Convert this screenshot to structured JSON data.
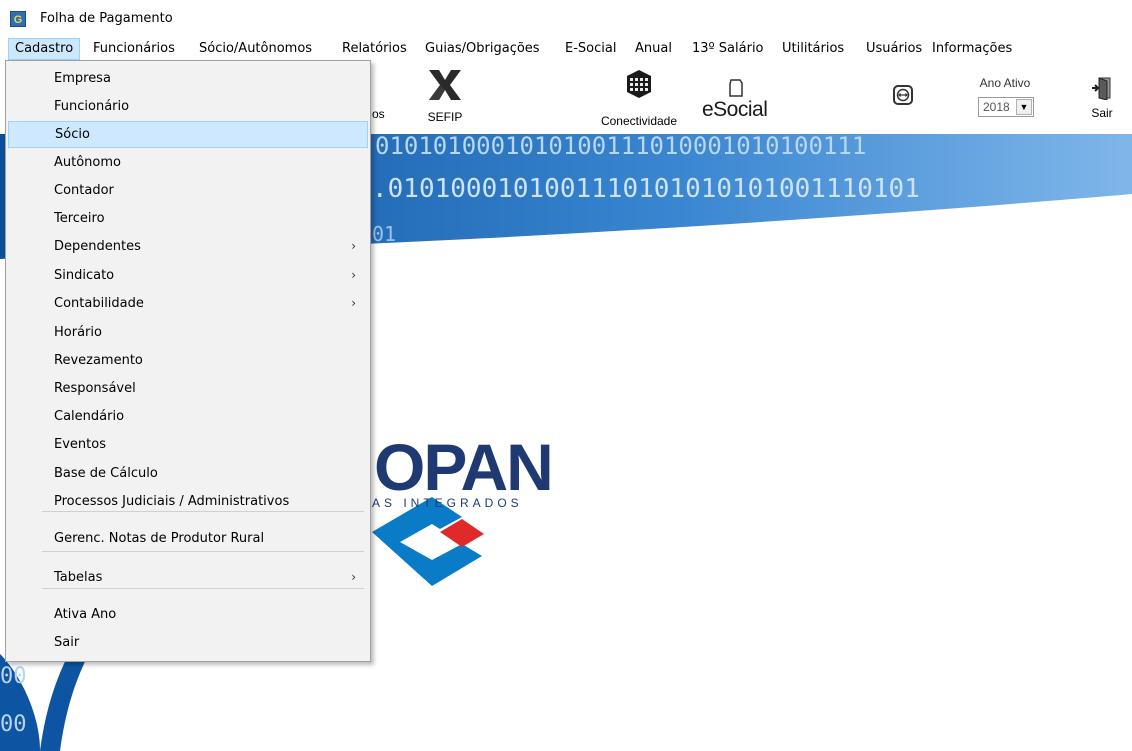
{
  "window": {
    "title": "Folha de Pagamento",
    "app_icon": "G"
  },
  "menubar": [
    "Cadastro",
    "Funcionários",
    "Sócio/Autônomos",
    "Relatórios",
    "Guias/Obrigações",
    "E-Social",
    "Anual",
    "13º Salário",
    "Utilitários",
    "Usuários",
    "Informações"
  ],
  "toolbar": {
    "partial_label": "os",
    "sefip_label": "SEFIP",
    "conectividade_label": "Conectividade",
    "esocial_label": "eSocial",
    "ano_ativo_label": "Ano Ativo",
    "ano_ativo_value": "2018",
    "sair_label": "Sair"
  },
  "banner": {
    "bits_row1": "0101010001010100111010001010100111",
    "bits_row2": ".0101000101001110101010101001110101",
    "bits_row3": "01",
    "bits_left1": "00",
    "bits_left2": "00",
    "logo_text": "OPAN",
    "logo_sub": "AS INTEGRADOS"
  },
  "cadastro_menu": {
    "items": [
      {
        "label": "Empresa",
        "sub": false
      },
      {
        "label": "Funcionário",
        "sub": false
      },
      {
        "label": "Sócio",
        "sub": false
      },
      {
        "label": "Autônomo",
        "sub": false
      },
      {
        "label": "Contador",
        "sub": false
      },
      {
        "label": "Terceiro",
        "sub": false
      },
      {
        "label": "Dependentes",
        "sub": true
      },
      {
        "label": "Sindicato",
        "sub": true
      },
      {
        "label": "Contabilidade",
        "sub": true
      },
      {
        "label": "Horário",
        "sub": false
      },
      {
        "label": "Revezamento",
        "sub": false
      },
      {
        "label": "Responsável",
        "sub": false
      },
      {
        "label": "Calendário",
        "sub": false
      },
      {
        "label": "Eventos",
        "sub": false
      },
      {
        "label": "Base de Cálculo",
        "sub": false
      },
      {
        "label": "Processos Judiciais / Administrativos",
        "sub": false
      },
      {
        "label": "Gerenc. Notas de Produtor Rural",
        "sub": false
      },
      {
        "label": "Tabelas",
        "sub": true
      },
      {
        "label": "Ativa Ano",
        "sub": false
      },
      {
        "label": "Sair",
        "sub": false
      }
    ],
    "highlighted_index": 2,
    "submenu_arrow": "›"
  },
  "colors": {
    "menu_highlight": "#cde8ff",
    "banner_blue": "#0f5aa6",
    "logo_red": "#e02a2a",
    "logo_navy": "#1f3a73"
  }
}
